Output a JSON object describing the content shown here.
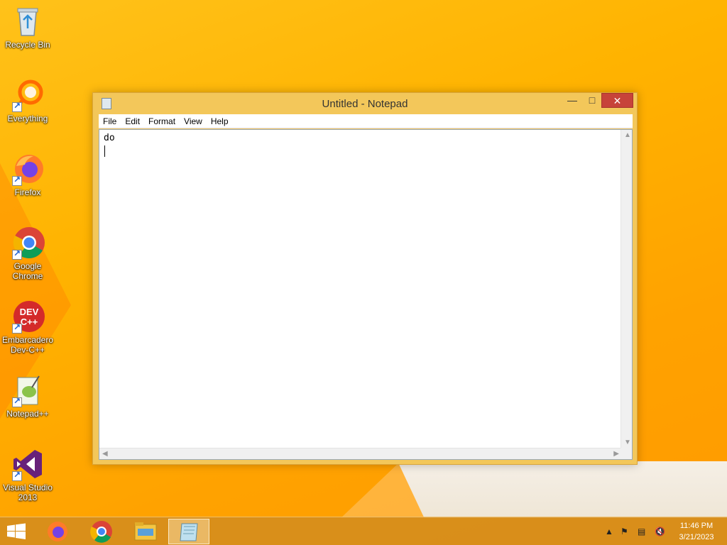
{
  "desktop": {
    "icons": [
      {
        "label": "Recycle Bin"
      },
      {
        "label": "Everything"
      },
      {
        "label": "Firefox"
      },
      {
        "label": "Google Chrome"
      },
      {
        "label": "Embarcadero Dev-C++"
      },
      {
        "label": "Notepad++"
      },
      {
        "label": "Visual Studio 2013"
      }
    ]
  },
  "notepad": {
    "title": "Untitled - Notepad",
    "menu": [
      "File",
      "Edit",
      "Format",
      "View",
      "Help"
    ],
    "content": "do"
  },
  "taskbar": {
    "time": "11:46 PM",
    "date": "3/21/2023"
  },
  "colors": {
    "wallpaper": "#ffb300",
    "close_button": "#c7433a",
    "window_frame": "#f3c75a"
  }
}
